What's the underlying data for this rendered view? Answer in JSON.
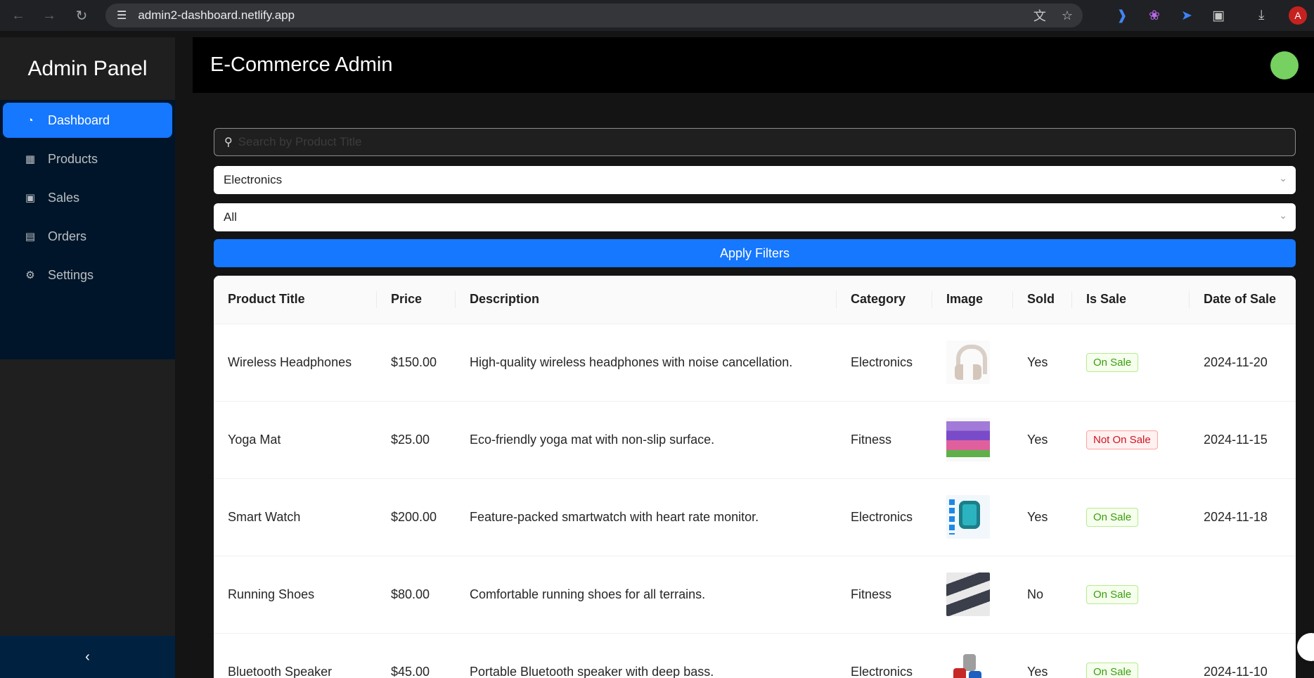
{
  "browser": {
    "url": "admin2-dashboard.netlify.app",
    "profile_initial": "A"
  },
  "sidebar": {
    "brand": "Admin Panel",
    "items": [
      {
        "label": "Dashboard",
        "icon": "dashboard-icon",
        "active": true
      },
      {
        "label": "Products",
        "icon": "shop-icon",
        "active": false
      },
      {
        "label": "Sales",
        "icon": "cart-icon",
        "active": false
      },
      {
        "label": "Orders",
        "icon": "file-icon",
        "active": false
      },
      {
        "label": "Settings",
        "icon": "gear-icon",
        "active": false
      }
    ],
    "collapse_glyph": "‹"
  },
  "header": {
    "title": "E-Commerce Admin"
  },
  "filters": {
    "search_placeholder": "Search by Product Title",
    "search_value": "",
    "category_value": "Electronics",
    "sale_value": "All",
    "apply_label": "Apply Filters"
  },
  "table": {
    "columns": [
      "Product Title",
      "Price",
      "Description",
      "Category",
      "Image",
      "Sold",
      "Is Sale",
      "Date of Sale"
    ],
    "rows": [
      {
        "title": "Wireless Headphones",
        "price": "$150.00",
        "description": "High-quality wireless headphones with noise cancellation.",
        "category": "Electronics",
        "image": "headphones-image",
        "sold": "Yes",
        "sale": "On Sale",
        "sale_status": "on",
        "date": "2024-11-20"
      },
      {
        "title": "Yoga Mat",
        "price": "$25.00",
        "description": "Eco-friendly yoga mat with non-slip surface.",
        "category": "Fitness",
        "image": "yoga-mat-image",
        "sold": "Yes",
        "sale": "Not On Sale",
        "sale_status": "off",
        "date": "2024-11-15"
      },
      {
        "title": "Smart Watch",
        "price": "$200.00",
        "description": "Feature-packed smartwatch with heart rate monitor.",
        "category": "Electronics",
        "image": "smartwatch-image",
        "sold": "Yes",
        "sale": "On Sale",
        "sale_status": "on",
        "date": "2024-11-18"
      },
      {
        "title": "Running Shoes",
        "price": "$80.00",
        "description": "Comfortable running shoes for all terrains.",
        "category": "Fitness",
        "image": "shoes-image",
        "sold": "No",
        "sale": "On Sale",
        "sale_status": "on",
        "date": ""
      },
      {
        "title": "Bluetooth Speaker",
        "price": "$45.00",
        "description": "Portable Bluetooth speaker with deep bass.",
        "category": "Electronics",
        "image": "speaker-image",
        "sold": "Yes",
        "sale": "On Sale",
        "sale_status": "on",
        "date": "2024-11-10"
      }
    ]
  },
  "colors": {
    "primary": "#1677ff",
    "sidebar_menu_bg": "#001529",
    "header_bg": "#000000",
    "avatar_green": "#76d160",
    "tag_green": "#389e0d",
    "tag_red": "#cf1322"
  }
}
